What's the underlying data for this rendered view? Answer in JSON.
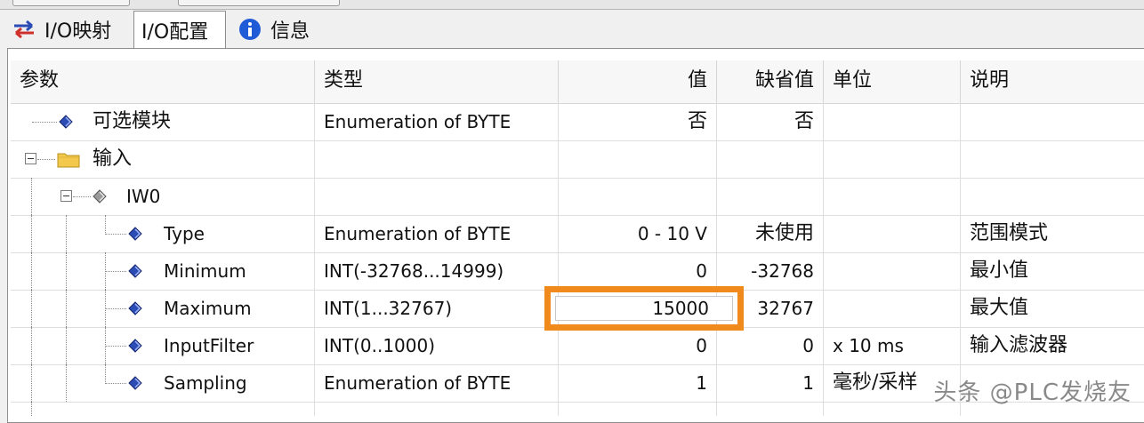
{
  "tabs": [
    {
      "label": "I/O映射",
      "icon": "swap-arrows-icon",
      "active": false
    },
    {
      "label": "I/O配置",
      "icon": "",
      "active": true
    },
    {
      "label": "信息",
      "icon": "info-icon",
      "active": false
    }
  ],
  "columns": {
    "param": "参数",
    "type": "类型",
    "value": "值",
    "default": "缺省值",
    "unit": "单位",
    "desc": "说明"
  },
  "rows": [
    {
      "name": "可选模块",
      "type": "Enumeration of BYTE",
      "value": "否",
      "default": "否",
      "unit": "",
      "desc": ""
    },
    {
      "name": "输入",
      "type": "",
      "value": "",
      "default": "",
      "unit": "",
      "desc": ""
    },
    {
      "name": "IW0",
      "type": "",
      "value": "",
      "default": "",
      "unit": "",
      "desc": ""
    },
    {
      "name": "Type",
      "type": "Enumeration of BYTE",
      "value": "0 - 10 V",
      "default": "未使用",
      "unit": "",
      "desc": "范围模式"
    },
    {
      "name": "Minimum",
      "type": "INT(-32768...14999)",
      "value": "0",
      "default": "-32768",
      "unit": "",
      "desc": "最小值"
    },
    {
      "name": "Maximum",
      "type": "INT(1...32767)",
      "value": "15000",
      "default": "32767",
      "unit": "",
      "desc": "最大值"
    },
    {
      "name": "InputFilter",
      "type": "INT(0..1000)",
      "value": "0",
      "default": "0",
      "unit": "x 10 ms",
      "desc": "输入滤波器"
    },
    {
      "name": "Sampling",
      "type": "Enumeration of BYTE",
      "value": "1",
      "default": "1",
      "unit": "毫秒/采样",
      "desc": ""
    }
  ],
  "watermark": "头条 @PLC发烧友",
  "colors": {
    "highlight": "#f08a1c",
    "icon_blue": "#2b4bb5",
    "folder": "#f2c94c"
  }
}
